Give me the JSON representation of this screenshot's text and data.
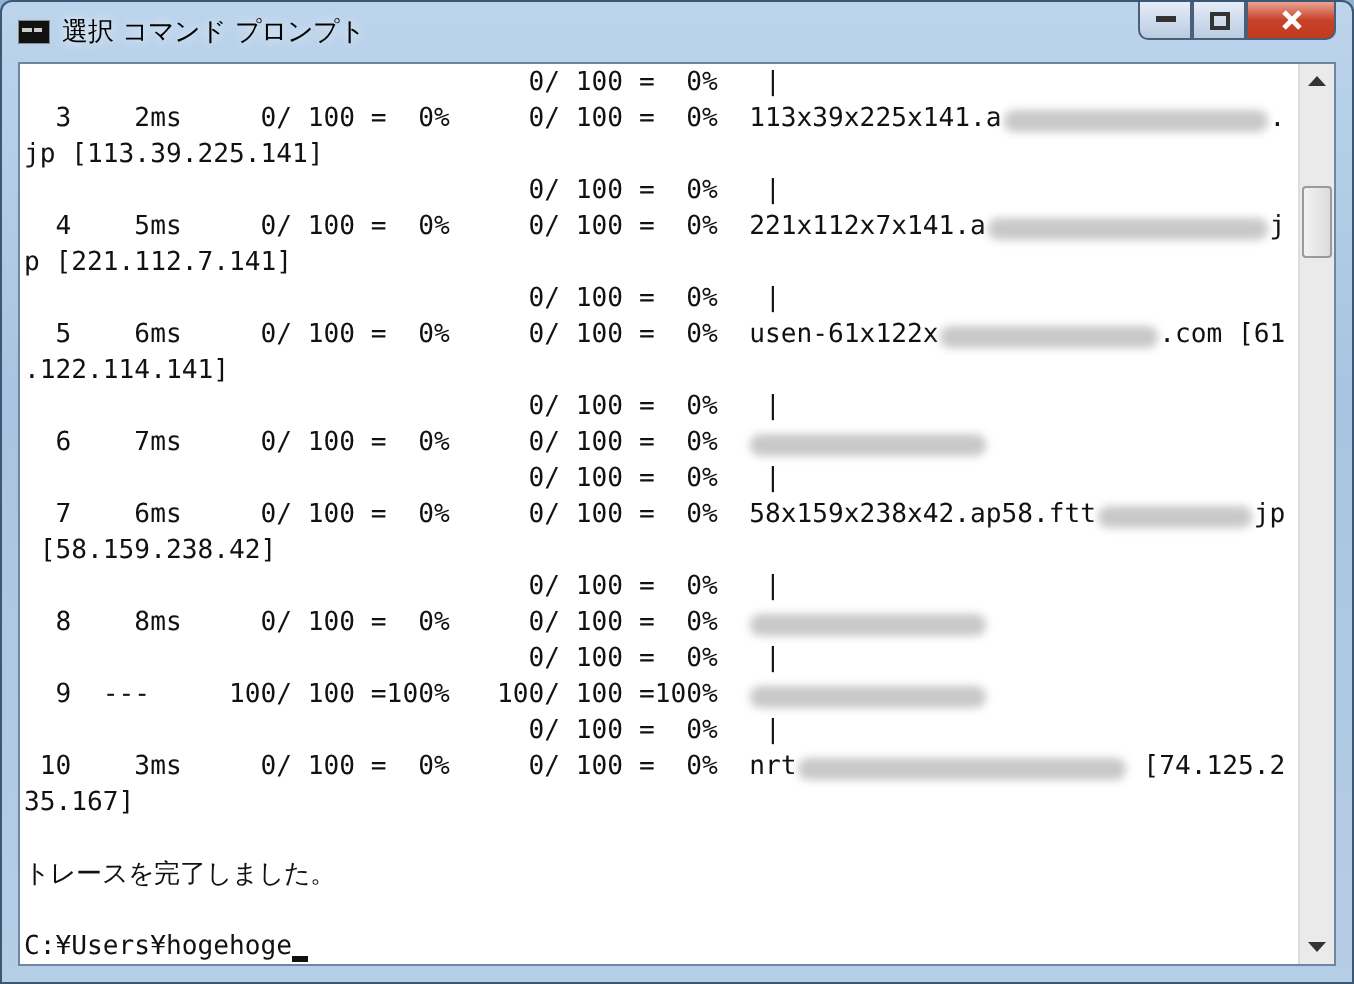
{
  "window": {
    "title": "選択 コマンド プロンプト"
  },
  "console": {
    "lines": [
      [
        {
          "kind": "text",
          "text": "                                0/ 100 =  0%   |"
        }
      ],
      [
        {
          "kind": "text",
          "text": "  3    2ms     0/ 100 =  0%     0/ 100 =  0%  113x39x225x141.a"
        },
        {
          "kind": "blur"
        },
        {
          "kind": "text",
          "text": "."
        }
      ],
      [
        {
          "kind": "text",
          "text": "jp [113.39.225.141]"
        }
      ],
      [
        {
          "kind": "text",
          "text": "                                0/ 100 =  0%   |"
        }
      ],
      [
        {
          "kind": "text",
          "text": "  4    5ms     0/ 100 =  0%     0/ 100 =  0%  221x112x7x141.a"
        },
        {
          "kind": "blur"
        },
        {
          "kind": "text",
          "text": "j"
        }
      ],
      [
        {
          "kind": "text",
          "text": "p [221.112.7.141]"
        }
      ],
      [
        {
          "kind": "text",
          "text": "                                0/ 100 =  0%   |"
        }
      ],
      [
        {
          "kind": "text",
          "text": "  5    6ms     0/ 100 =  0%     0/ 100 =  0%  usen-61x122x"
        },
        {
          "kind": "blur"
        },
        {
          "kind": "text",
          "text": ".com [61"
        }
      ],
      [
        {
          "kind": "text",
          "text": ".122.114.141]"
        }
      ],
      [
        {
          "kind": "text",
          "text": "                                0/ 100 =  0%   |"
        }
      ],
      [
        {
          "kind": "text",
          "text": "  6    7ms     0/ 100 =  0%     0/ 100 =  0%  "
        },
        {
          "kind": "blur-short"
        }
      ],
      [
        {
          "kind": "text",
          "text": "                                0/ 100 =  0%   |"
        }
      ],
      [
        {
          "kind": "text",
          "text": "  7    6ms     0/ 100 =  0%     0/ 100 =  0%  58x159x238x42.ap58.ftt"
        },
        {
          "kind": "blur"
        },
        {
          "kind": "text",
          "text": "jp"
        }
      ],
      [
        {
          "kind": "text",
          "text": " [58.159.238.42]"
        }
      ],
      [
        {
          "kind": "text",
          "text": "                                0/ 100 =  0%   |"
        }
      ],
      [
        {
          "kind": "text",
          "text": "  8    8ms     0/ 100 =  0%     0/ 100 =  0%  "
        },
        {
          "kind": "blur-short"
        }
      ],
      [
        {
          "kind": "text",
          "text": "                                0/ 100 =  0%   |"
        }
      ],
      [
        {
          "kind": "text",
          "text": "  9  ---     100/ 100 =100%   100/ 100 =100%  "
        },
        {
          "kind": "blur-short"
        }
      ],
      [
        {
          "kind": "text",
          "text": "                                0/ 100 =  0%   |"
        }
      ],
      [
        {
          "kind": "text",
          "text": " 10    3ms     0/ 100 =  0%     0/ 100 =  0%  nrt"
        },
        {
          "kind": "blur"
        },
        {
          "kind": "text",
          "text": " [74.125.2"
        }
      ],
      [
        {
          "kind": "text",
          "text": "35.167]"
        }
      ],
      [
        {
          "kind": "blank"
        }
      ],
      [
        {
          "kind": "text",
          "text": "トレースを完了しました。"
        }
      ],
      [
        {
          "kind": "blank"
        }
      ],
      [
        {
          "kind": "text",
          "text": "C:¥Users¥hogehoge"
        },
        {
          "kind": "cursor"
        }
      ]
    ]
  }
}
